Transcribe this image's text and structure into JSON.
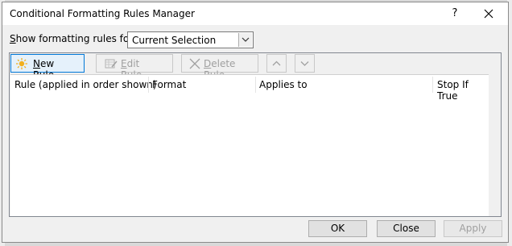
{
  "dialog": {
    "title": "Conditional Formatting Rules Manager",
    "help_label": "?",
    "close_label": "Close window"
  },
  "filter": {
    "label_prefix": "S",
    "label_rest": "how formatting rules for:",
    "selected": "Current Selection"
  },
  "toolbar": {
    "new_rule_u": "N",
    "new_rule_rest": "ew Rule...",
    "edit_rule_u": "E",
    "edit_rule_rest": "dit Rule...",
    "delete_rule_u": "D",
    "delete_rule_rest": "elete Rule"
  },
  "table": {
    "columns": [
      "Rule (applied in order shown)",
      "Format",
      "Applies to",
      "Stop If True"
    ]
  },
  "footer": {
    "ok": "OK",
    "close": "Close",
    "apply": "Apply"
  },
  "colors": {
    "accent": "#0078d7",
    "disabled_text": "#a0a0a0"
  }
}
